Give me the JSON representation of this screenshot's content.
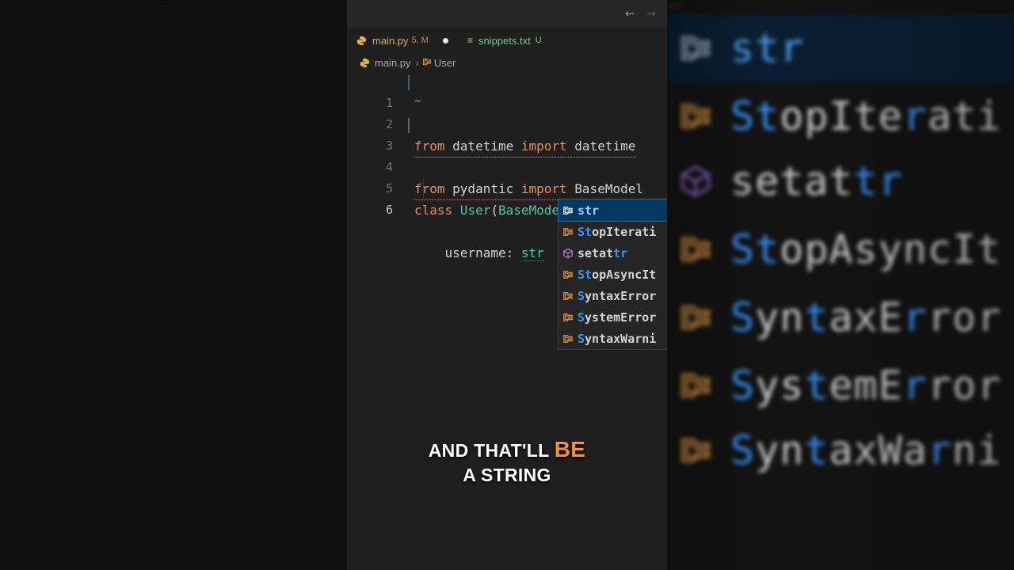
{
  "window": {
    "back_arrow": "←",
    "forward_arrow": "→"
  },
  "tabs": [
    {
      "label": "main.py",
      "meta": "5, M",
      "modified_dot": true,
      "icon": "python-icon"
    },
    {
      "label": "snippets.txt",
      "meta": "U",
      "icon": "text-file-icon"
    }
  ],
  "breadcrumb": {
    "file": "main.py",
    "symbol": "User"
  },
  "code": {
    "line_numbers": [
      "1",
      "2",
      "3",
      "4",
      "5",
      "6"
    ],
    "line1": {
      "kw1": "from",
      "mod": " datetime ",
      "kw2": "import",
      "name": " datetime"
    },
    "line2_tilde": "~",
    "line3": {
      "kw1": "from",
      "mod": " pydantic ",
      "kw2": "import",
      "name": " BaseModel"
    },
    "line5": {
      "kw": "class",
      "cls": " User",
      "open": "(",
      "base": "BaseModel",
      "close": "):"
    },
    "line6": {
      "field": "    username: ",
      "typed": "str"
    }
  },
  "autocomplete": [
    {
      "pre": "",
      "hl": "str",
      "post": "",
      "icon": "class-icon",
      "selected": true
    },
    {
      "pre": "",
      "hl": "St",
      "post": "opIterati",
      "icon": "class-icon"
    },
    {
      "pre": "setat",
      "hl": "tr",
      "post": "",
      "icon": "method-cube-icon"
    },
    {
      "pre": "",
      "hl": "St",
      "post": "opAsyncIt",
      "icon": "class-icon"
    },
    {
      "pre": "",
      "hl": "S",
      "post": "yntaxError",
      "icon": "class-icon"
    },
    {
      "pre": "",
      "hl": "S",
      "post": "ystemError",
      "icon": "class-icon"
    },
    {
      "pre": "",
      "hl": "S",
      "post": "yntaxWarni",
      "icon": "class-icon"
    }
  ],
  "zoomed_list": [
    {
      "text": "str",
      "selected": true
    },
    {
      "text": "StopIterati"
    },
    {
      "text": "setattr"
    },
    {
      "text": "StopAsyncIt"
    },
    {
      "text": "SyntaxError"
    },
    {
      "text": "SystemError"
    },
    {
      "text": "SyntaxWarni"
    }
  ],
  "caption": {
    "line1_a": "AND THAT'LL ",
    "line1_b": "BE",
    "line2": "A STRING"
  },
  "colors": {
    "keyword": "#e58c63",
    "class": "#4ec9b0",
    "match_highlight": "#3794ff",
    "selection": "#04395e",
    "caption_accent": "#f0914a"
  }
}
